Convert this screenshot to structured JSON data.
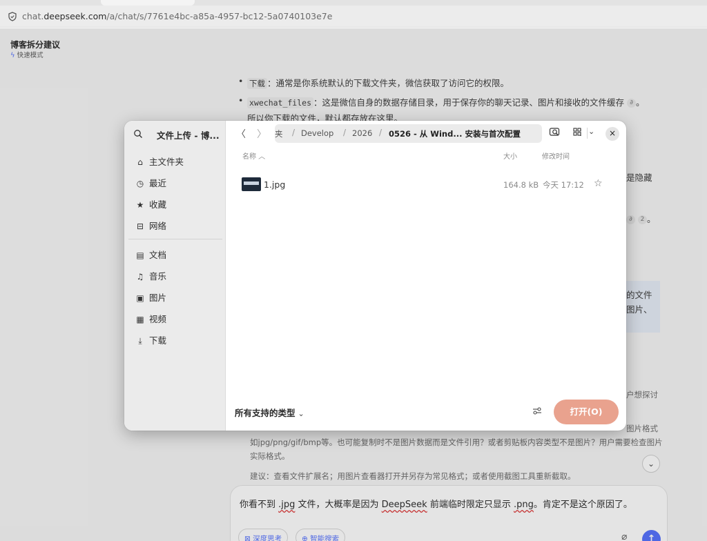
{
  "browser": {
    "url_prefix": "chat.",
    "url_domain": "deepseek.com",
    "url_path": "/a/chat/s/7761e4bc-a85a-4957-bc12-5a0740103e7e"
  },
  "conversation": {
    "title": "博客拆分建议",
    "mode": "快速模式"
  },
  "background": {
    "bullet1_code": "下载",
    "bullet1_text": "：通常是你系统默认的下载文件夹，微信获取了访问它的权限。",
    "bullet2_code": "xwechat_files",
    "bullet2_text": "：这是微信自身的数据存储目录，用于保存你的聊天记录、图片和接收的文件缓存",
    "bullet2_end": "。",
    "line3": "所以你下载的文件，默认都存放在这里。",
    "frag_hidden": "是隐藏",
    "cite_num": "2",
    "cite_end": "。",
    "frag_file": "的文件",
    "frag_image": "图片、",
    "frag_want": "户想探讨",
    "think1": "如jpg/png/gif/bmp等。也可能复制时不是图片数据而是文件引用？或者剪贴板内容类型不是图片？用户需要检查图片",
    "think1b": "图片格式",
    "think2": "实际格式。",
    "think3": "建议：查看文件扩展名；用图片查看器打开并另存为常见格式；或者使用截图工具重新截取。"
  },
  "composer": {
    "text_a": "你看不到 ",
    "text_b": ".jpg",
    "text_c": " 文件，大概率是因为 ",
    "text_d": "DeepSeek",
    "text_e": " 前端临时限定只显示 ",
    "text_f": ".png",
    "text_g": "。肯定不是这个原因了。",
    "deep_think": "深度思考",
    "web_search": "智能搜索"
  },
  "dialog": {
    "title": "文件上传 - 博...",
    "places": [
      {
        "icon": "home-icon",
        "glyph": "⌂",
        "label": "主文件夹"
      },
      {
        "icon": "recent-icon",
        "glyph": "◷",
        "label": "最近"
      },
      {
        "icon": "star-icon",
        "glyph": "★",
        "label": "收藏"
      },
      {
        "icon": "network-icon",
        "glyph": "⊟",
        "label": "网络"
      }
    ],
    "bookmarks": [
      {
        "icon": "document-icon",
        "glyph": "▤",
        "label": "文档"
      },
      {
        "icon": "music-icon",
        "glyph": "♫",
        "label": "音乐"
      },
      {
        "icon": "picture-icon",
        "glyph": "▣",
        "label": "图片"
      },
      {
        "icon": "video-icon",
        "glyph": "▦",
        "label": "视频"
      },
      {
        "icon": "download-icon",
        "glyph": "⤓",
        "label": "下载"
      }
    ],
    "back": "〈",
    "forward": "〉",
    "breadcrumb": [
      "夹",
      "Develop",
      "2026",
      "0526 - 从 Wind...  安装与首次配置"
    ],
    "columns": {
      "name": "名称",
      "size": "大小",
      "modified": "修改时间"
    },
    "files": [
      {
        "name": "1.jpg",
        "size": "164.8 kB",
        "modified": "今天 17:12"
      }
    ],
    "filter": "所有支持的类型",
    "open_button": "打开(O)"
  }
}
